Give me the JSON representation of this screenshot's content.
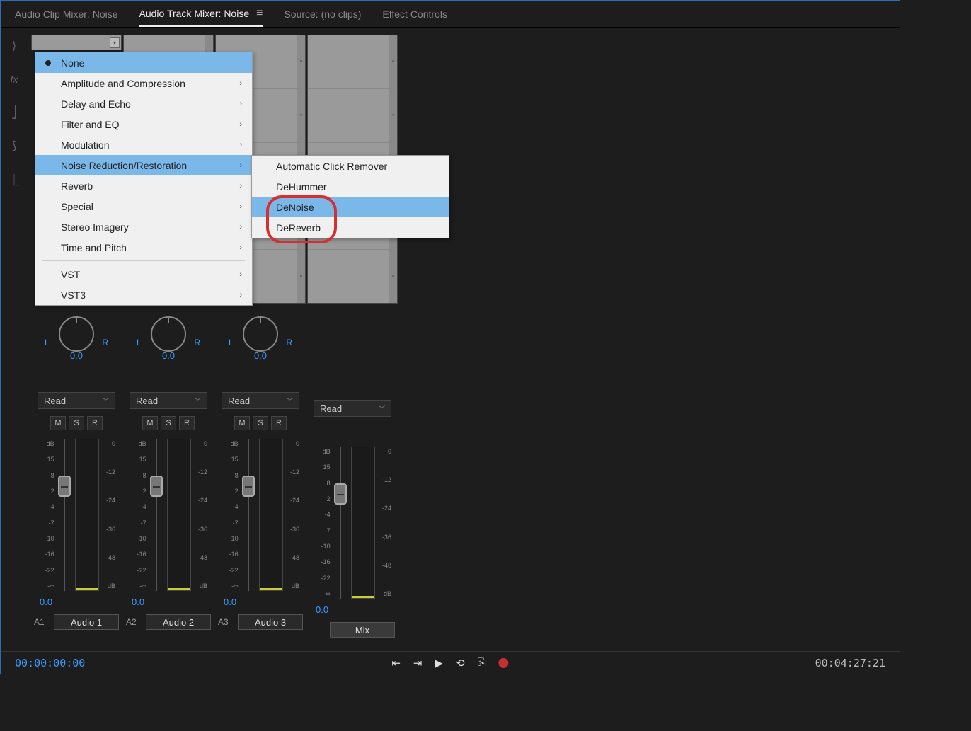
{
  "tabs": {
    "clip_mixer": "Audio Clip Mixer: Noise",
    "track_mixer": "Audio Track Mixer: Noise",
    "source": "Source: (no clips)",
    "effect_controls": "Effect Controls"
  },
  "context_menu": {
    "none": "None",
    "items": [
      "Amplitude and Compression",
      "Delay and Echo",
      "Filter and EQ",
      "Modulation",
      "Noise Reduction/Restoration",
      "Reverb",
      "Special",
      "Stereo Imagery",
      "Time and Pitch"
    ],
    "vst_items": [
      "VST",
      "VST3"
    ]
  },
  "submenu": {
    "items": [
      "Automatic Click Remover",
      "DeHummer",
      "DeNoise",
      "DeReverb"
    ]
  },
  "pan": {
    "left": "L",
    "right": "R",
    "value": "0.0"
  },
  "read_label": "Read",
  "msr": {
    "m": "M",
    "s": "S",
    "r": "R"
  },
  "fader_scale_left": [
    "dB",
    "15",
    "8",
    "2",
    "-4",
    "-7",
    "-10",
    "-16",
    "-22",
    "-∞"
  ],
  "fader_scale_right": [
    "0",
    "-12",
    "-24",
    "-36",
    "-48",
    "dB"
  ],
  "db_value": "0.0",
  "tracks": [
    {
      "id": "A1",
      "name": "Audio 1"
    },
    {
      "id": "A2",
      "name": "Audio 2"
    },
    {
      "id": "A3",
      "name": "Audio 3"
    },
    {
      "id": "",
      "name": "Mix"
    }
  ],
  "footer": {
    "left_time": "00:00:00:00",
    "right_time": "00:04:27:21"
  }
}
